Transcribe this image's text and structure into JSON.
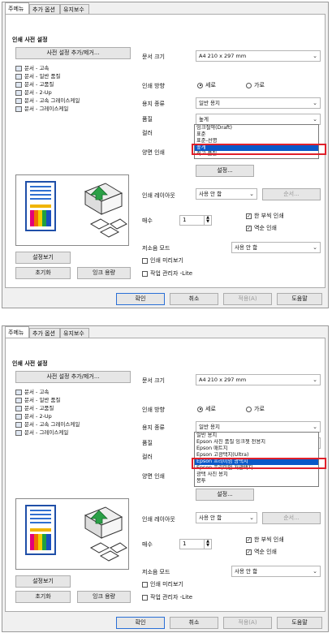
{
  "tabs": [
    "주메뉴",
    "추가 옵션",
    "유지보수"
  ],
  "preset_title": "인쇄 사전 설정",
  "preset_add_button": "사전 설정 추가/제거...",
  "presets": [
    "문서 - 고속",
    "문서 - 일반 품질",
    "문서 - 고품질",
    "문서 - 2-Up",
    "문서 - 고속 그레이스케일",
    "문서 - 그레이스케일"
  ],
  "labels": {
    "paper_size": "문서 크기",
    "orientation": "인쇄 방향",
    "paper_type": "용지 종류",
    "quality": "품질",
    "color": "컬러",
    "duplex": "양면 인쇄",
    "layout": "인쇄 레이아웃",
    "copies": "매수",
    "quiet_mode": "저소음 모드"
  },
  "values": {
    "paper_size": "A4 210 x 297 mm",
    "portrait": "세로",
    "landscape": "가로",
    "paper_type": "일반 용지",
    "quality": "높게",
    "duplex_settings": "설정...",
    "layout": "사용 안 함",
    "order": "순서...",
    "copies": "1",
    "collate": "한 부씩 인쇄",
    "reverse": "역순 인쇄",
    "quiet_mode": "사용 안 함"
  },
  "checks": {
    "print_preview": "인쇄 미리보기",
    "job_arranger": "작업 관리자 -Lite"
  },
  "left_buttons": {
    "show_settings": "설정보기",
    "reset": "초기화",
    "ink_levels": "잉크 용량"
  },
  "footer": {
    "ok": "확인",
    "cancel": "취소",
    "apply": "적용(A)",
    "help": "도움말"
  },
  "quality_options": [
    "잉크절약(Draft)",
    "표준",
    "표준-선명",
    "높게",
    "최고 품질"
  ],
  "quality_selected": "높게",
  "paper_options": [
    "일반 용지",
    "Epson 사진 품질 잉크젯 전용지",
    "Epson 매트지",
    "Epson 고광택지(Ultra)",
    "Epson 프리미엄 광택지",
    "Epson 프리미엄 저광택지",
    "광택 사진 용지",
    "봉투"
  ],
  "paper_selected": "Epson 프리미엄 광택지",
  "colors": {
    "selection": "#0a58c8",
    "highlight_box": "#e0202a",
    "default_button_border": "#2a6fd6"
  }
}
